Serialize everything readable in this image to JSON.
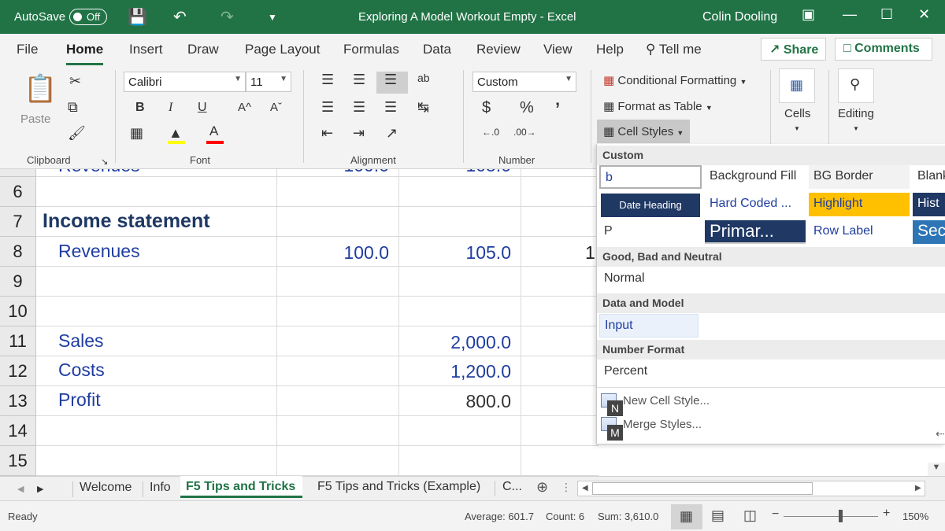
{
  "titlebar": {
    "autosave_label": "AutoSave",
    "autosave_state": "Off",
    "document": "Exploring A Model Workout Empty  -  Excel",
    "user": "Colin Dooling"
  },
  "menu": {
    "tabs": [
      "File",
      "Home",
      "Insert",
      "Draw",
      "Page Layout",
      "Formulas",
      "Data",
      "Review",
      "View",
      "Help"
    ],
    "tell_me": "Tell me",
    "share": "Share",
    "comments": "Comments"
  },
  "ribbon": {
    "clipboard": {
      "paste": "Paste",
      "label": "Clipboard"
    },
    "font": {
      "name": "Calibri",
      "size": "11",
      "bold": "B",
      "italic": "I",
      "underline": "U",
      "grow": "A^",
      "shrink": "Aˇ",
      "label": "Font"
    },
    "alignment": {
      "label": "Alignment"
    },
    "number": {
      "format": "Custom",
      "currency": "$",
      "percent": "%",
      "comma": "’",
      "label": "Number"
    },
    "styles": {
      "conditional": "Conditional Formatting",
      "format_table": "Format as Table",
      "cell_styles": "Cell Styles"
    },
    "cells": {
      "label": "Cells"
    },
    "editing": {
      "label": "Editing"
    }
  },
  "grid": {
    "partial_cells": [
      "Revenues",
      "100.0",
      "105.0"
    ],
    "row_numbers": [
      "6",
      "7",
      "8",
      "9",
      "10",
      "11",
      "12",
      "13",
      "14",
      "15"
    ],
    "income_statement": "Income statement",
    "revenues_label": "Revenues",
    "revenues_c": "100.0",
    "revenues_d": "105.0",
    "revenues_e_partial": "1",
    "sales_label": "Sales",
    "sales_d": "2,000.0",
    "costs_label": "Costs",
    "costs_d": "1,200.0",
    "profit_label": "Profit",
    "profit_d": "800.0"
  },
  "cell_styles_gallery": {
    "sections": {
      "custom": "Custom",
      "good_bad": "Good, Bad and Neutral",
      "data_model": "Data and Model",
      "number_format": "Number Format"
    },
    "custom_row1": [
      "b",
      "Background Fill",
      "BG Border",
      "Blank"
    ],
    "custom_row2": [
      "Date Heading",
      "Hard Coded ...",
      "Highlight",
      "Hist"
    ],
    "custom_row3": [
      "P",
      "Primar...",
      "Row Label",
      "Sec"
    ],
    "normal": "Normal",
    "input": "Input",
    "percent": "Percent",
    "new_style": "New Cell Style...",
    "merge_styles": "Merge Styles...",
    "keytip_new": "N",
    "keytip_merge": "M"
  },
  "sheets": {
    "tabs": [
      "Welcome",
      "Info",
      "F5 Tips and Tricks",
      "F5 Tips and Tricks (Example)",
      "C..."
    ],
    "active": "F5 Tips and Tricks"
  },
  "status": {
    "ready": "Ready",
    "average": "Average: 601.7",
    "count": "Count: 6",
    "sum": "Sum: 3,610.0",
    "zoom": "150%"
  },
  "colors": {
    "excel_green": "#217346",
    "cell_blue": "#1f3da0",
    "navy": "#1f3864",
    "highlight": "#ffc000"
  }
}
